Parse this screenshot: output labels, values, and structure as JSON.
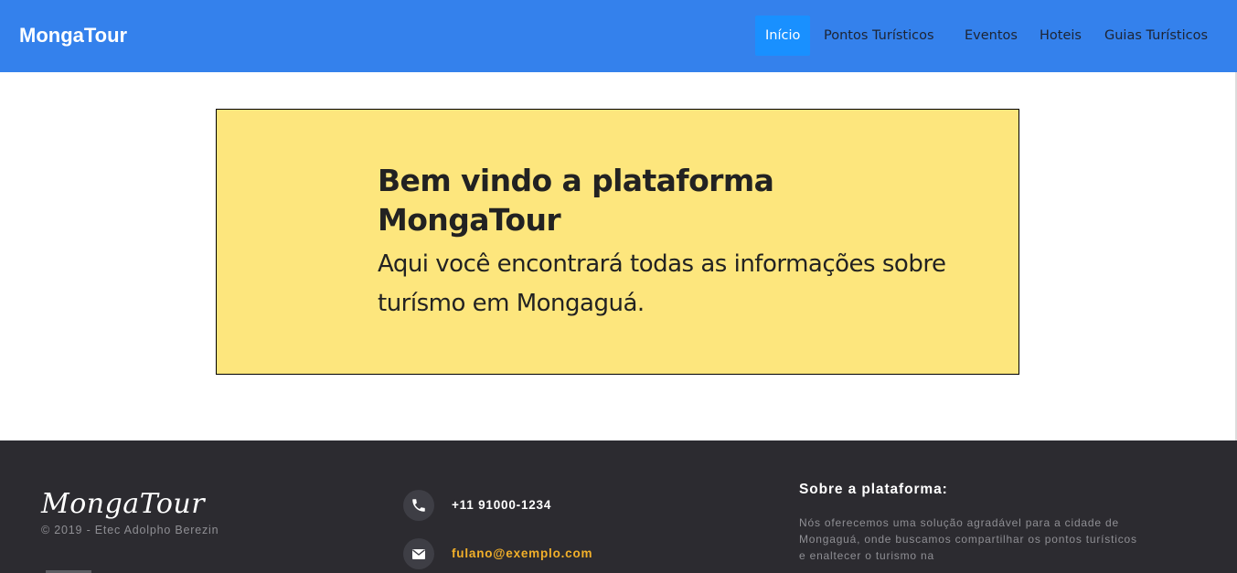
{
  "navbar": {
    "brand": "MongaTour",
    "links": [
      {
        "label": "Início",
        "active": true
      },
      {
        "label": "Pontos Turísticos",
        "active": false
      },
      {
        "label": "Eventos",
        "active": false
      },
      {
        "label": "Hoteis",
        "active": false
      },
      {
        "label": "Guias Turísticos",
        "active": false
      }
    ]
  },
  "hero": {
    "title": "Bem vindo a plataforma MongaTour",
    "subtitle": "Aqui você encontrará todas as informações sobre turísmo em Mongaguá."
  },
  "footer": {
    "logo": "MongaTour",
    "copyright": "© 2019 - Etec Adolpho Berezin",
    "phone": "+11 91000-1234",
    "email": "fulano@exemplo.com",
    "phone_icon": "phone-icon",
    "email_icon": "envelope-icon",
    "about_title": "Sobre a plataforma:",
    "about_text": "Nós oferecemos uma solução agradável para a cidade de Mongaguá, onde buscamos compartilhar os pontos turísticos e enaltecer o turismo na"
  },
  "colors": {
    "navbar_bg": "#3481ec",
    "active_link_bg": "#1990ff",
    "hero_bg": "#fde67d",
    "footer_bg": "#2c2b30",
    "email_accent": "#f2b02a"
  }
}
